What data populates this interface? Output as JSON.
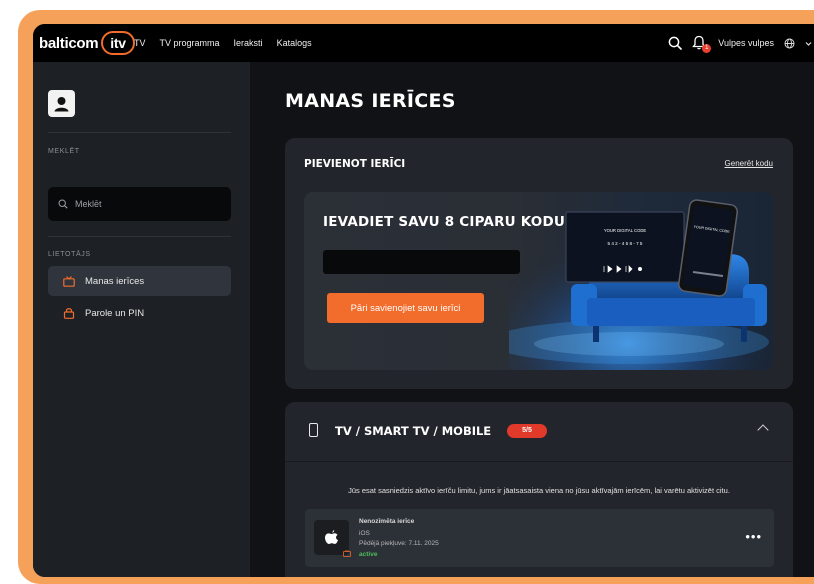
{
  "header": {
    "logo_text": "balticom",
    "logo_itv": "itv",
    "nav": [
      "TV",
      "TV programma",
      "Ieraksti",
      "Katalogs"
    ],
    "notification_count": "1",
    "user_name": "Vulpes vulpes"
  },
  "sidebar": {
    "search_section": "MEKLĒT",
    "search_placeholder": "Meklēt",
    "user_section": "LIETOTĀJS",
    "items": [
      {
        "label": "Manas ierīces",
        "active": true
      },
      {
        "label": "Parole un PIN",
        "active": false
      }
    ]
  },
  "main": {
    "page_title": "MANAS IERĪCES",
    "add_card": {
      "title": "PIEVIENOT IERĪCI",
      "generate_link": "Generēt kodu",
      "banner_title": "IEVADIET SAVU 8 CIPARU KODU",
      "code_value": "",
      "connect_button": "Pāri savienojiet savu ierīci",
      "art_tv_text": "YOUR DIGITAL CODE",
      "art_tv_digits": "5 4 2 - 4 5 8 - 7 5",
      "art_phone_text": "YOUR DIGITAL CODE"
    },
    "devices_card": {
      "title": "TV / SMART TV / MOBILE",
      "count": "5/5",
      "limit_message": "Jūs esat sasniedzis aktīvo ierīču limitu, jums ir jāatsasaista viena no jūsu aktīvajām ierīcēm, lai varētu aktivizēt citu.",
      "devices": [
        {
          "name": "Nenozīmēta ierīce",
          "os": "iOS",
          "last_access": "Pēdējā piekļuve: 7.11. 2025",
          "status": "active"
        }
      ]
    }
  },
  "colors": {
    "accent": "#f26c2c",
    "frame": "#f5a15a",
    "badge": "#e23a2a",
    "active_status": "#4fbf5a"
  }
}
